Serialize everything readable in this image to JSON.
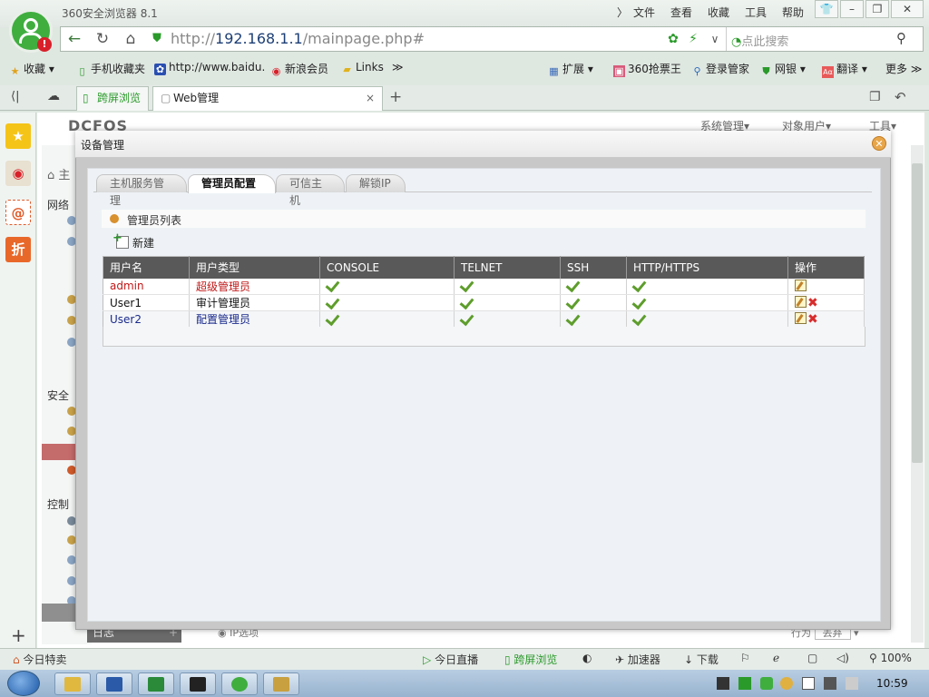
{
  "browser": {
    "app_name": "360安全浏览器 8.1",
    "menu": [
      "文件",
      "查看",
      "收藏",
      "工具",
      "帮助"
    ],
    "window_buttons": [
      "👕",
      "–",
      "❐",
      "✕"
    ],
    "url_host": "192.168.1.1",
    "url_prefix": "http://",
    "url_path": "/mainpage.php#",
    "search_placeholder": "点此搜索",
    "bookmarks": [
      "收藏",
      "手机收藏夹",
      "http://www.baidu.",
      "新浪会员",
      "Links"
    ],
    "bookmarks_right": [
      "扩展",
      "360抢票王",
      "登录管家",
      "网银",
      "翻译",
      "更多"
    ],
    "tabs": [
      "跨屏浏览",
      "Web管理"
    ],
    "tab_close": "×",
    "tab_new": "+"
  },
  "page": {
    "brand": "DCFOS",
    "top_menu": [
      "系统管理",
      "对象用户",
      "工具"
    ],
    "nav_sections": [
      "网络",
      "安全",
      "控制"
    ],
    "home_label": "主",
    "log_label": "日志",
    "ip_option": "IP选项",
    "action_label": "行为",
    "action_value": "丢弃"
  },
  "modal": {
    "title": "设备管理",
    "tabs": [
      "主机服务管理",
      "管理员配置",
      "可信主机",
      "解锁IP"
    ],
    "active_tab": "管理员配置",
    "section_title": "管理员列表",
    "new_button": "新建",
    "columns": [
      "用户名",
      "用户类型",
      "CONSOLE",
      "TELNET",
      "SSH",
      "HTTP/HTTPS",
      "操作"
    ],
    "rows": [
      {
        "username": "admin",
        "type": "超级管理员",
        "console": true,
        "telnet": true,
        "ssh": true,
        "http": true,
        "deletable": false,
        "color": "#c01818"
      },
      {
        "username": "User1",
        "type": "审计管理员",
        "console": true,
        "telnet": true,
        "ssh": true,
        "http": true,
        "deletable": true,
        "color": "#111111"
      },
      {
        "username": "User2",
        "type": "配置管理员",
        "console": true,
        "telnet": true,
        "ssh": true,
        "http": true,
        "deletable": true,
        "color": "#1a2a8c"
      }
    ]
  },
  "statusbar": {
    "left": "今日特卖",
    "items": [
      "今日直播",
      "跨屏浏览",
      "加速器",
      "下载"
    ],
    "zoom": "100%"
  },
  "taskbar": {
    "clock": "10:59"
  },
  "colors": {
    "green": "#3fae3f",
    "header_dark": "#595959",
    "accent_orange": "#d8912e"
  }
}
